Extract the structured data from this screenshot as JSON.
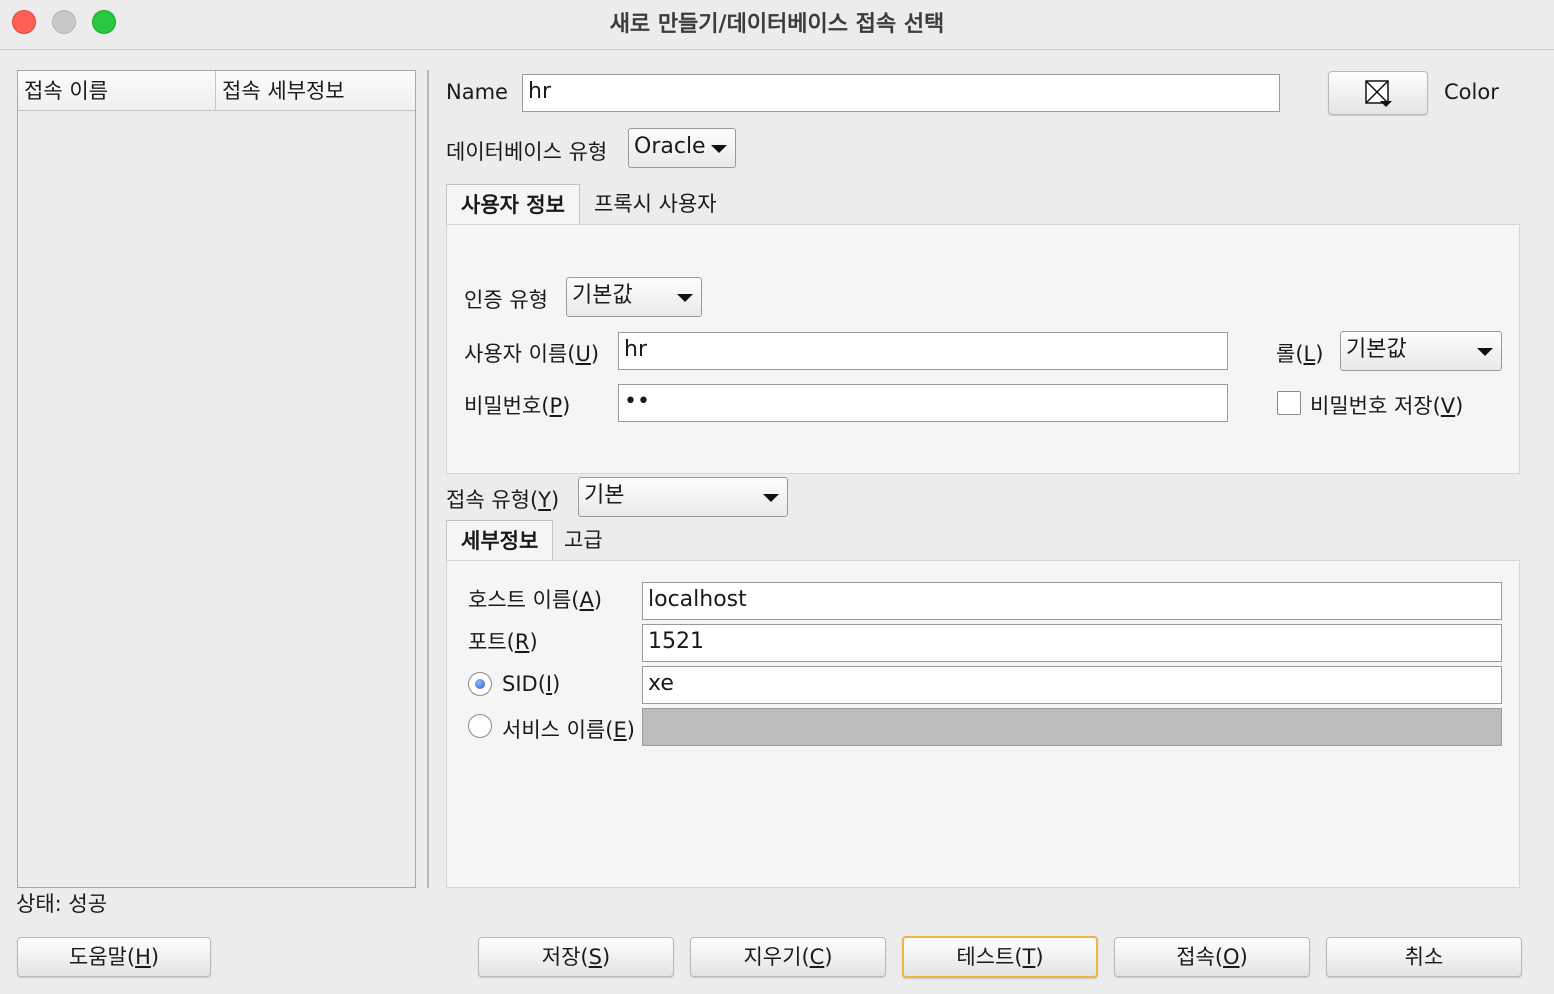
{
  "window": {
    "title": "새로 만들기/데이터베이스 접속 선택"
  },
  "list": {
    "col_name": "접속 이름",
    "col_details": "접속 세부정보"
  },
  "status": "상태: 성공",
  "name": {
    "label": "Name",
    "value": "hr"
  },
  "color": {
    "label": "Color",
    "icon": "color-picker-icon"
  },
  "db_type": {
    "label": "데이터베이스 유형",
    "value": "Oracle"
  },
  "tabs_top": [
    {
      "label": "사용자 정보",
      "active": true
    },
    {
      "label": "프록시 사용자",
      "active": false
    }
  ],
  "auth": {
    "label": "인증 유형",
    "value": "기본값"
  },
  "username": {
    "label": "사용자 이름(",
    "mnemonic": "U",
    "suffix": ")",
    "value": "hr"
  },
  "password": {
    "label": "비밀번호(",
    "mnemonic": "P",
    "suffix": ")",
    "value": "••"
  },
  "role": {
    "label": "롤(",
    "mnemonic": "L",
    "suffix": ")",
    "value": "기본값"
  },
  "save_password": {
    "label": "비밀번호 저장(",
    "mnemonic": "V",
    "suffix": ")",
    "checked": false
  },
  "conn_type": {
    "label": "접속 유형(",
    "mnemonic": "Y",
    "suffix": ")",
    "value": "기본"
  },
  "tabs_bottom": [
    {
      "label": "세부정보",
      "active": true
    },
    {
      "label": "고급",
      "active": false
    }
  ],
  "host": {
    "label": "호스트 이름(",
    "mnemonic": "A",
    "suffix": ")",
    "value": "localhost"
  },
  "port": {
    "label": "포트(",
    "mnemonic": "R",
    "suffix": ")",
    "value": "1521"
  },
  "sid": {
    "label": "SID(",
    "mnemonic": "I",
    "suffix": ")",
    "value": "xe",
    "selected": true
  },
  "service": {
    "label": "서비스 이름(",
    "mnemonic": "E",
    "suffix": ")",
    "value": "",
    "selected": false
  },
  "buttons": {
    "help": {
      "label": "도움말(",
      "mnemonic": "H",
      "suffix": ")"
    },
    "save": {
      "label": "저장(",
      "mnemonic": "S",
      "suffix": ")"
    },
    "clear": {
      "label": "지우기(",
      "mnemonic": "C",
      "suffix": ")"
    },
    "test": {
      "label": "테스트(",
      "mnemonic": "T",
      "suffix": ")"
    },
    "connect": {
      "label": "접속(",
      "mnemonic": "O",
      "suffix": ")"
    },
    "cancel": {
      "label": "취소"
    }
  },
  "colors": {
    "focus_border": "#f0b345",
    "close": "#fe5f57",
    "maximize": "#28c840"
  }
}
